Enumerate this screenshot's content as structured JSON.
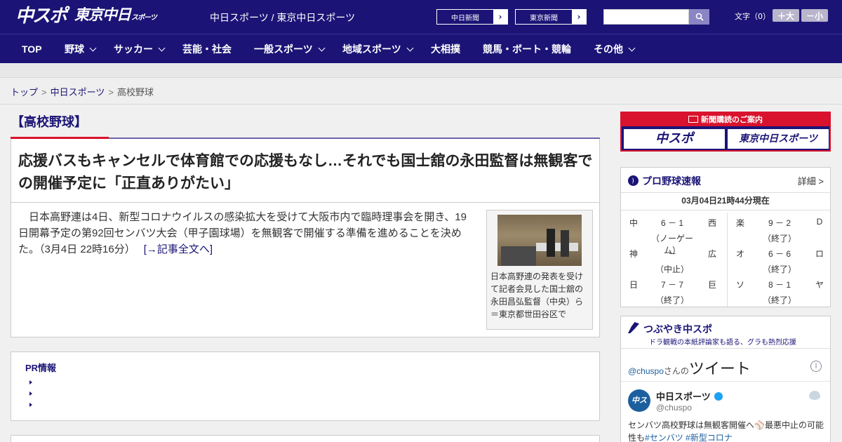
{
  "header": {
    "logo_main": "中スポ",
    "logo_tokyo": "東京中日",
    "logo_tokyo_small": "スポーツ",
    "site_title": "中日スポーツ / 東京中日スポーツ",
    "newspaper_buttons": [
      {
        "label": "中日新聞"
      },
      {
        "label": "東京新聞"
      }
    ],
    "search_placeholder": "",
    "font_size_label": "文字（0）",
    "font_larger": "＋大",
    "font_smaller": "－小"
  },
  "nav": {
    "items": [
      {
        "label": "TOP",
        "has_dropdown": false
      },
      {
        "label": "野球",
        "has_dropdown": true
      },
      {
        "label": "サッカー",
        "has_dropdown": true
      },
      {
        "label": "芸能・社会",
        "has_dropdown": false
      },
      {
        "label": "一般スポーツ",
        "has_dropdown": true
      },
      {
        "label": "地域スポーツ",
        "has_dropdown": true
      },
      {
        "label": "大相撲",
        "has_dropdown": false
      },
      {
        "label": "競馬・ボート・競輪",
        "has_dropdown": false
      },
      {
        "label": "その他",
        "has_dropdown": true
      }
    ]
  },
  "breadcrumb": {
    "items": [
      "トップ",
      "中日スポーツ",
      "高校野球"
    ],
    "separator": ">"
  },
  "section_title": "【高校野球】",
  "article": {
    "headline": "応援バスもキャンセルで体育館での応援もなし…それでも国士舘の永田監督は無観客での開催予定に「正直ありがたい」",
    "body": "　日本高野連は4日、新型コロナウイルスの感染拡大を受けて大阪市内で臨時理事会を開き、19日開幕予定の第92回センバツ大会（甲子園球場）を無観客で開催する準備を進めることを決めた。（3月4日 22時16分）",
    "read_more": "[→記事全文へ]",
    "photo_caption": "日本高野連の発表を受けて記者会見した国士舘の永田昌弘監督（中央）ら＝東京都世田谷区で"
  },
  "pr": {
    "title": "PR情報",
    "items": [
      "",
      "",
      ""
    ]
  },
  "sidebar": {
    "subscribe_banner": {
      "title": "新聞購読のご案内",
      "logos": [
        "中スポ",
        "東京中日スポーツ"
      ]
    },
    "scores": {
      "title": "プロ野球速報",
      "detail_link": "詳細 >",
      "updated": "03月04日21時44分現在",
      "games": [
        {
          "home": "中",
          "score": "6 － 1",
          "away": "西",
          "status": "（ノーゲーム）"
        },
        {
          "home": "神",
          "score": "－",
          "away": "広",
          "status": "（中止）"
        },
        {
          "home": "日",
          "score": "7 － 7",
          "away": "巨",
          "status": "（終了）"
        },
        {
          "home": "楽",
          "score": "9 － 2",
          "away": "D",
          "status": "（終了）"
        },
        {
          "home": "オ",
          "score": "6 － 6",
          "away": "ロ",
          "status": "（終了）"
        },
        {
          "home": "ソ",
          "score": "8 － 1",
          "away": "ヤ",
          "status": "（終了）"
        }
      ]
    },
    "tweets": {
      "title": "つぶやき中スポ",
      "subtitle": "ドラ観戦の本紙評論家も語る、グラも熱烈応援",
      "header_handle": "@chuspo",
      "header_suffix": "さんの",
      "header_big": "ツイート",
      "info_icon": "i",
      "account_name": "中日スポーツ",
      "account_handle": "@chuspo",
      "avatar_text": "中スポ",
      "text_main": "センバツ高校野球は無観客開催へ⚾最悪中止の可能性も",
      "tags": [
        "#センバツ",
        "#新型コロナ"
      ]
    }
  }
}
